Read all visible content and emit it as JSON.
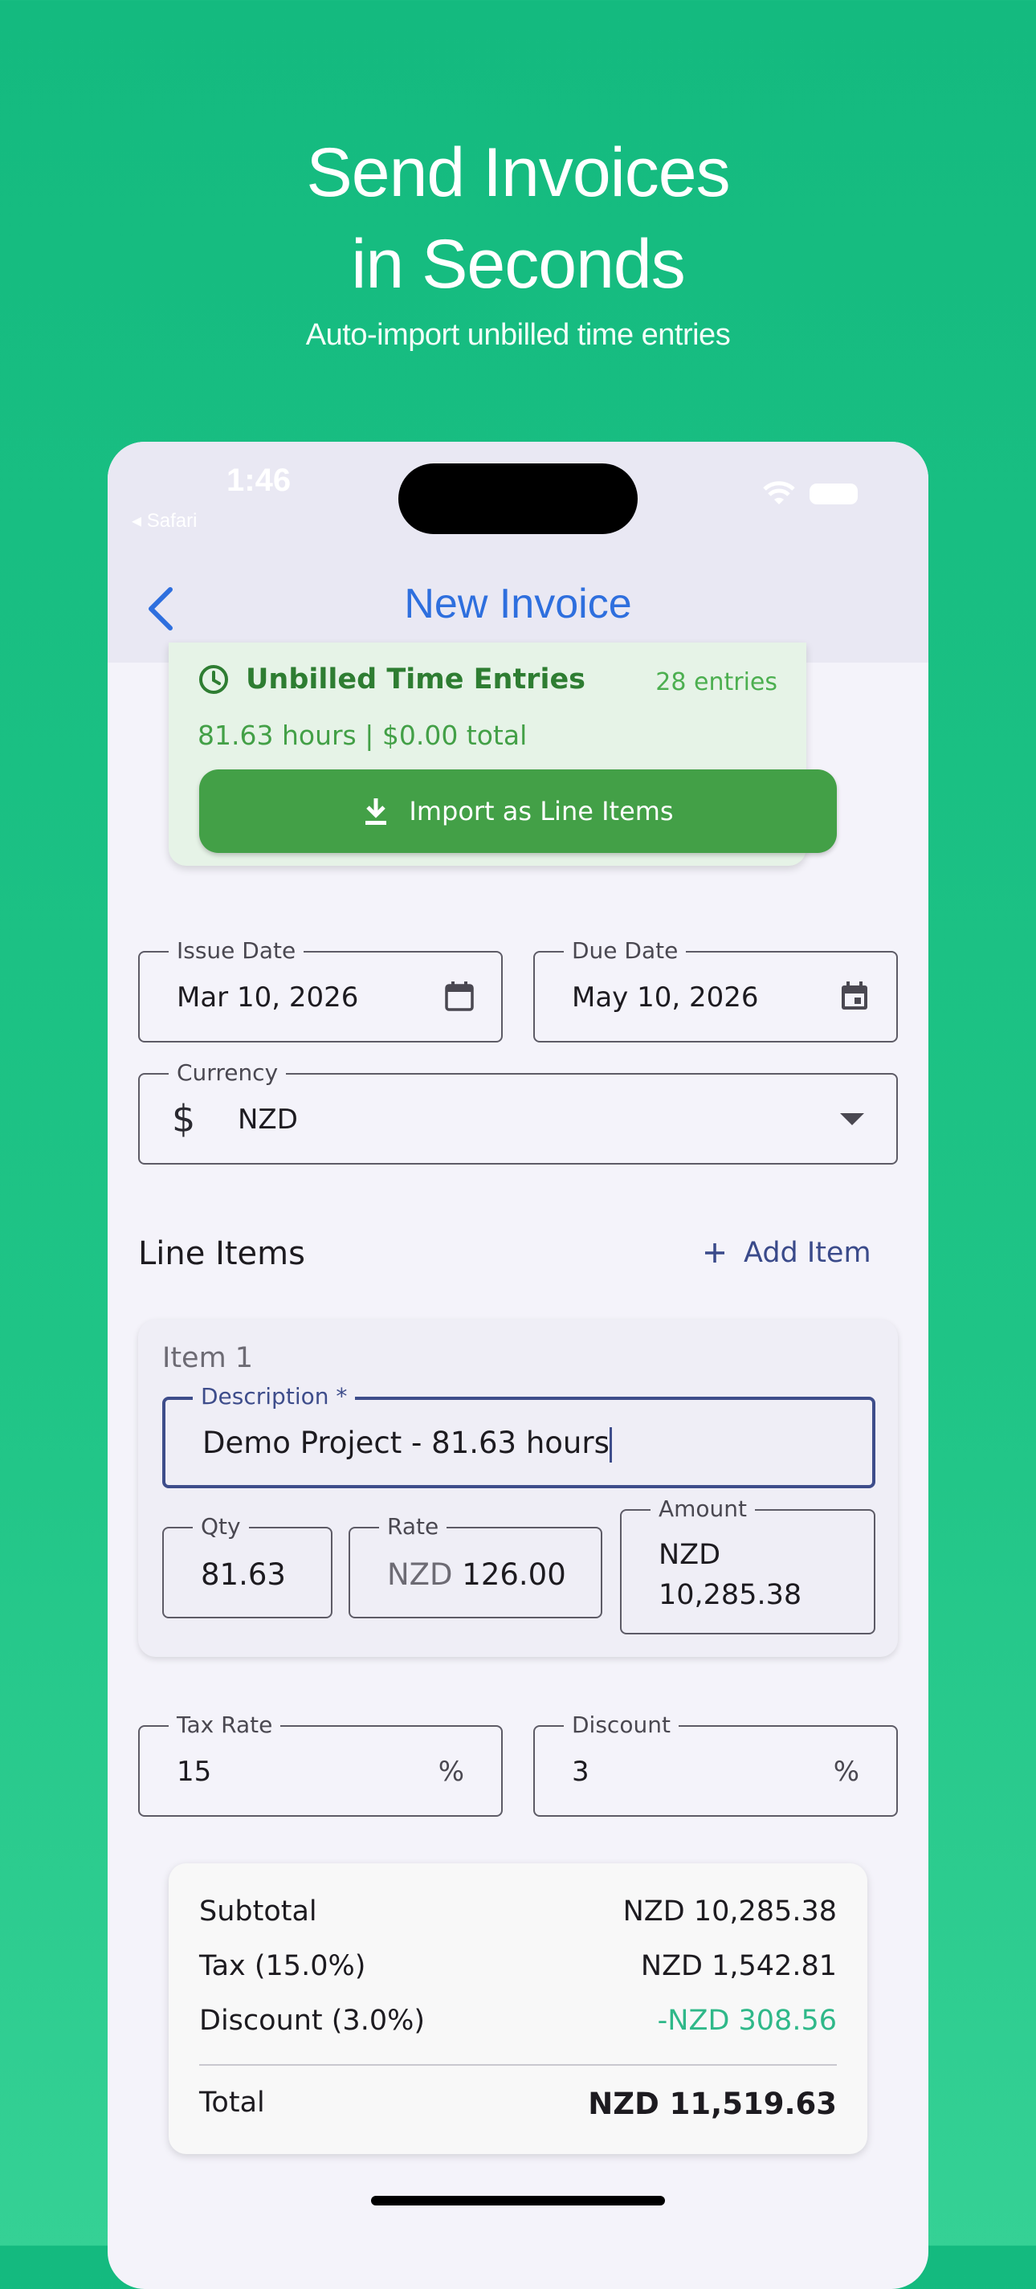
{
  "hero": {
    "title_line1": "Send Invoices",
    "title_line2": "in Seconds",
    "subtitle": "Auto-import unbilled time entries"
  },
  "status_bar": {
    "time": "1:46",
    "back_app": "◂ Safari",
    "icons": [
      "wifi-icon",
      "battery-icon"
    ]
  },
  "nav": {
    "title": "New Invoice",
    "back_icon": "chevron-left-icon"
  },
  "unbilled": {
    "title": "Unbilled Time Entries",
    "count": "28 entries",
    "summary": "81.63 hours  |  $0.00 total",
    "import_label": "Import as Line Items",
    "icon": "clock-icon"
  },
  "dates": {
    "issue_label": "Issue Date",
    "issue_value": "Mar 10, 2026",
    "due_label": "Due Date",
    "due_value": "May 10, 2026"
  },
  "currency": {
    "label": "Currency",
    "symbol": "$",
    "value": "NZD"
  },
  "line_items": {
    "title": "Line Items",
    "add_label": "Add Item",
    "items": [
      {
        "title": "Item 1",
        "description_label": "Description *",
        "description_value": "Demo Project - 81.63 hours",
        "qty_label": "Qty",
        "qty_value": "81.63",
        "rate_label": "Rate",
        "rate_prefix": "NZD",
        "rate_value": "126.00",
        "amount_label": "Amount",
        "amount_line1": "NZD",
        "amount_line2": "10,285.38"
      }
    ]
  },
  "tax": {
    "tax_label": "Tax Rate",
    "tax_value": "15",
    "discount_label": "Discount",
    "discount_value": "3",
    "percent": "%"
  },
  "summary": {
    "subtotal_label": "Subtotal",
    "subtotal_value": "NZD 10,285.38",
    "tax_label": "Tax (15.0%)",
    "tax_value": "NZD 1,542.81",
    "discount_label": "Discount (3.0%)",
    "discount_value": "-NZD 308.56",
    "total_label": "Total",
    "total_value": "NZD 11,519.63"
  },
  "colors": {
    "accent_green": "#43a047",
    "title_blue": "#2e6fde",
    "discount_teal": "#2fb889",
    "focus_indigo": "#3e4d8b"
  }
}
